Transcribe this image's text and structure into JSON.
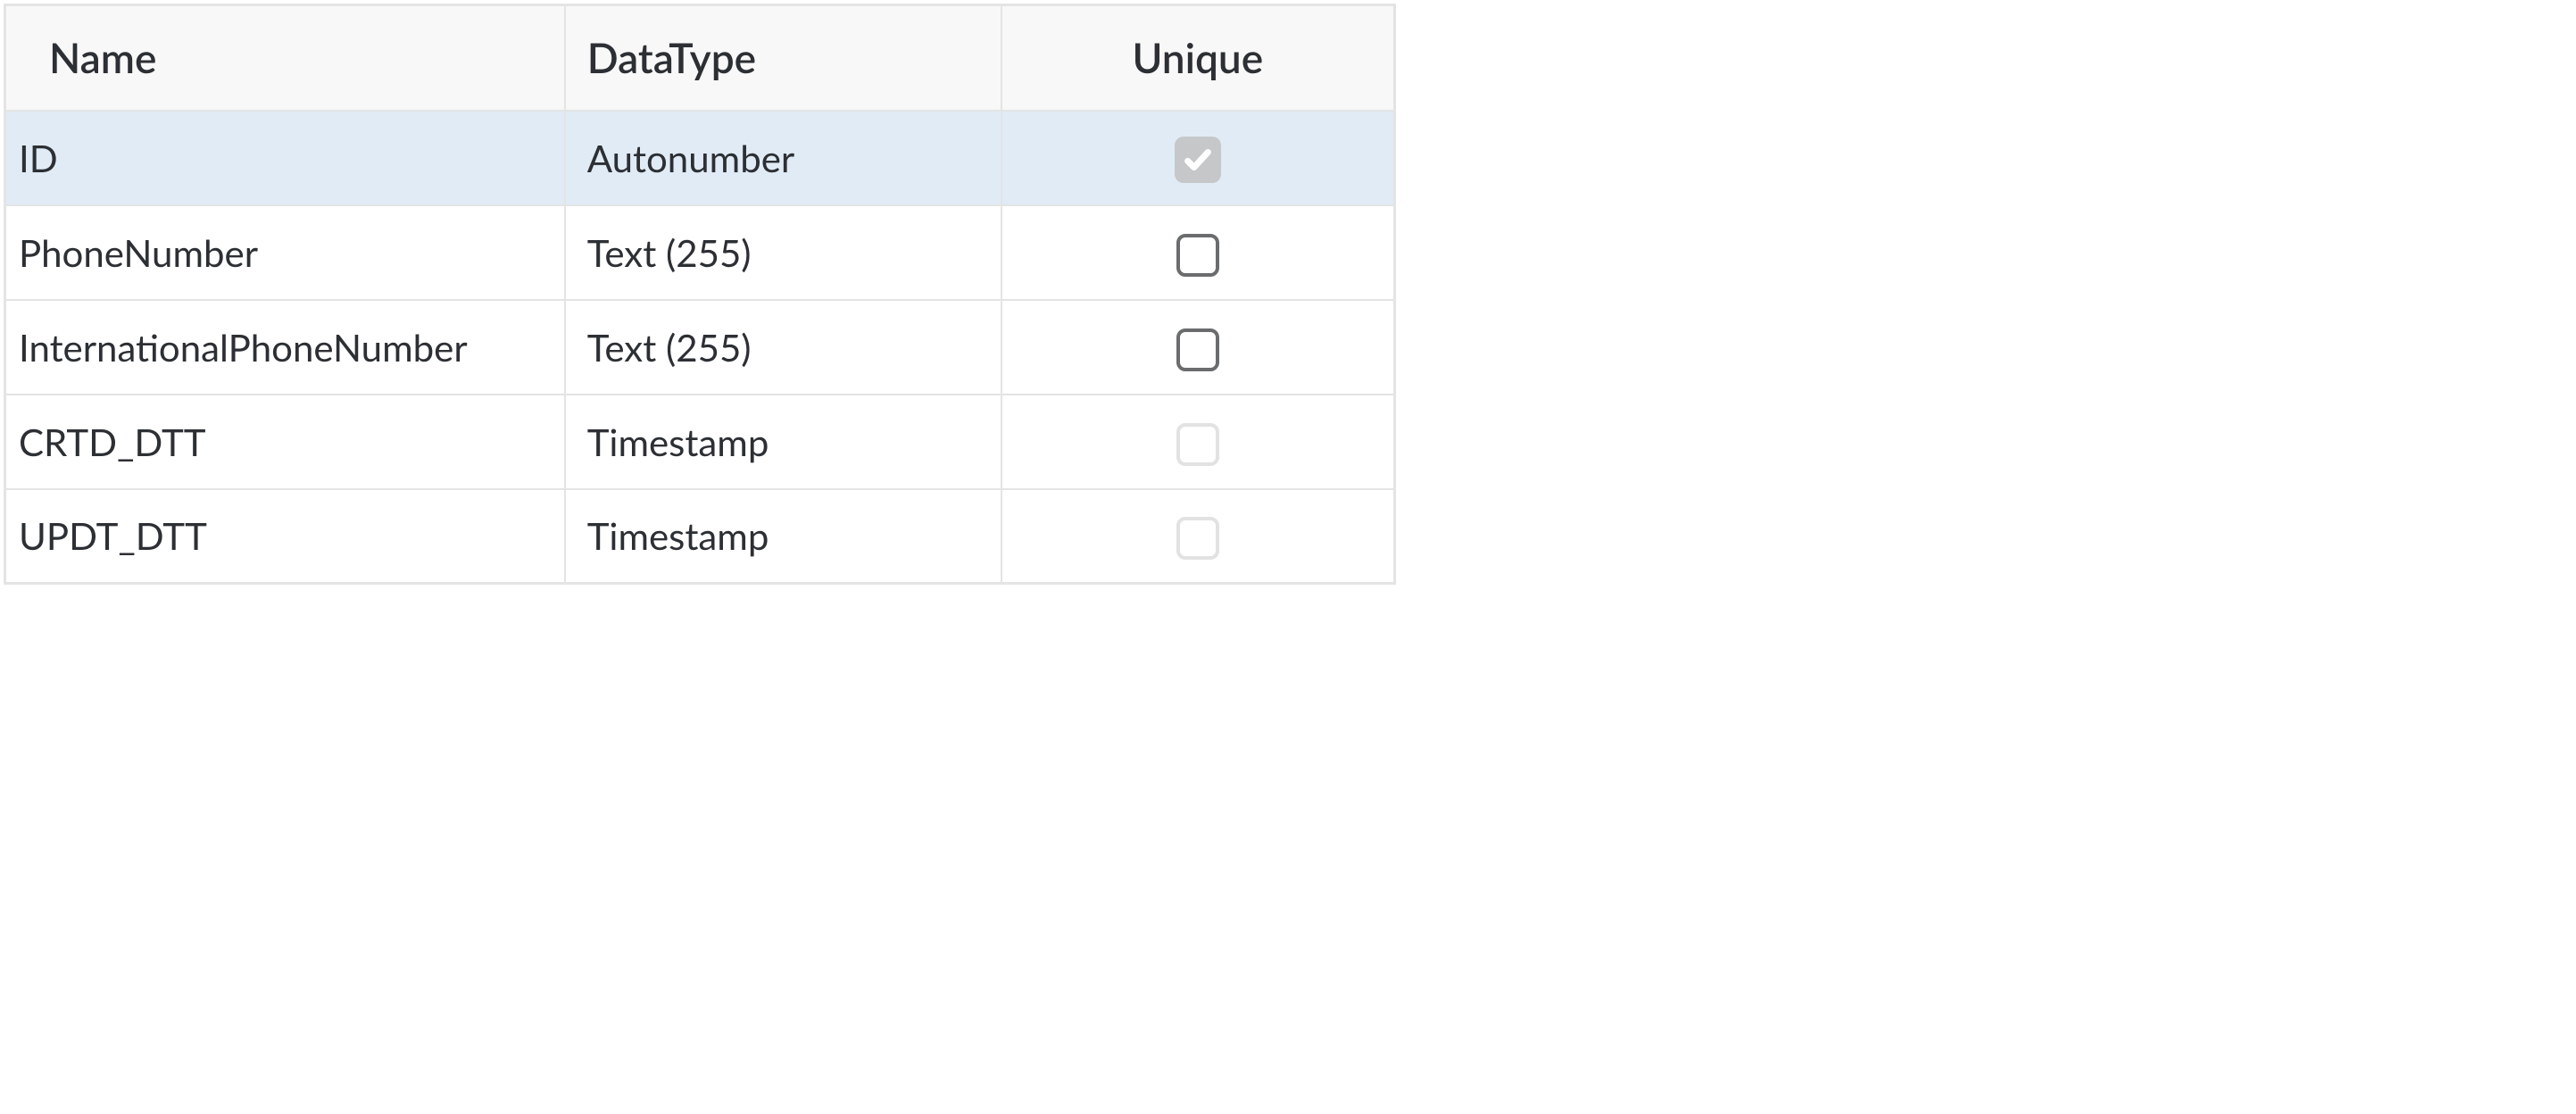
{
  "columns": {
    "name": "Name",
    "datatype": "DataType",
    "unique": "Unique"
  },
  "rows": [
    {
      "name": "ID",
      "datatype": "Autonumber",
      "unique_checked": true,
      "unique_disabled": true,
      "selected": true
    },
    {
      "name": "PhoneNumber",
      "datatype": "Text (255)",
      "unique_checked": false,
      "unique_disabled": false,
      "selected": false
    },
    {
      "name": "InternationalPhoneNumber",
      "datatype": "Text (255)",
      "unique_checked": false,
      "unique_disabled": false,
      "selected": false
    },
    {
      "name": "CRTD_DTT",
      "datatype": "Timestamp",
      "unique_checked": false,
      "unique_disabled": true,
      "selected": false
    },
    {
      "name": "UPDT_DTT",
      "datatype": "Timestamp",
      "unique_checked": false,
      "unique_disabled": true,
      "selected": false
    }
  ]
}
